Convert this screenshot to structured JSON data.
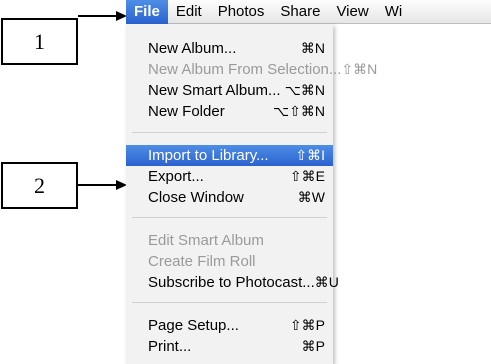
{
  "callouts": {
    "one": "1",
    "two": "2"
  },
  "menubar": {
    "items": [
      {
        "label": "File"
      },
      {
        "label": "Edit"
      },
      {
        "label": "Photos"
      },
      {
        "label": "Share"
      },
      {
        "label": "View"
      },
      {
        "label": "Wi"
      }
    ],
    "active_index": 0
  },
  "file_menu": {
    "items": [
      {
        "label": "New Album...",
        "shortcut": "⌘N",
        "enabled": true
      },
      {
        "label": "New Album From Selection...",
        "shortcut": "⇧⌘N",
        "enabled": false
      },
      {
        "label": "New Smart Album...",
        "shortcut": "⌥⌘N",
        "enabled": true
      },
      {
        "label": "New Folder",
        "shortcut": "⌥⇧⌘N",
        "enabled": true
      },
      {
        "label": "Import to Library...",
        "shortcut": "⇧⌘I",
        "enabled": true,
        "selected": true
      },
      {
        "label": "Export...",
        "shortcut": "⇧⌘E",
        "enabled": true
      },
      {
        "label": "Close Window",
        "shortcut": "⌘W",
        "enabled": true
      },
      {
        "label": "Edit Smart Album",
        "shortcut": "",
        "enabled": false
      },
      {
        "label": "Create Film Roll",
        "shortcut": "",
        "enabled": false
      },
      {
        "label": "Subscribe to Photocast...",
        "shortcut": "⌘U",
        "enabled": true
      },
      {
        "label": "Page Setup...",
        "shortcut": "⇧⌘P",
        "enabled": true
      },
      {
        "label": "Print...",
        "shortcut": "⌘P",
        "enabled": true
      }
    ]
  },
  "colors": {
    "accent": "#2a62cf",
    "disabled_text": "#9a9a9a"
  }
}
